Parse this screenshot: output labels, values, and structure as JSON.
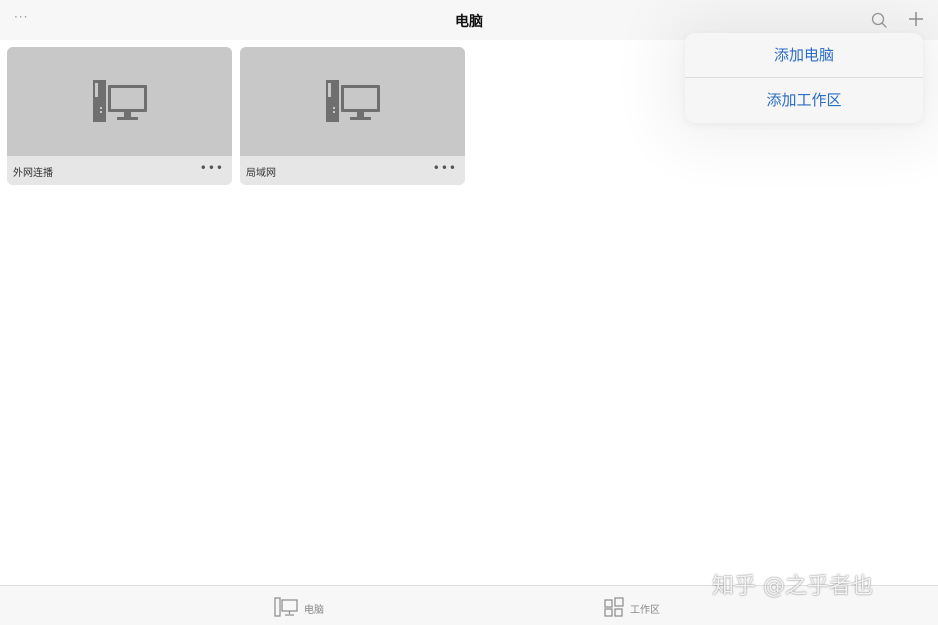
{
  "navbar": {
    "more_label": "···",
    "title": "电脑",
    "search_icon": "search-icon",
    "add_icon": "plus-icon"
  },
  "cards": [
    {
      "label": "外网连播",
      "more": "•••",
      "icon": "computer-icon"
    },
    {
      "label": "局域网",
      "more": "•••",
      "icon": "computer-icon"
    }
  ],
  "popover": {
    "items": [
      {
        "label": "添加电脑"
      },
      {
        "label": "添加工作区"
      }
    ]
  },
  "tabbar": {
    "tabs": [
      {
        "label": "电脑",
        "icon": "computer-icon"
      },
      {
        "label": "工作区",
        "icon": "workspace-icon"
      }
    ]
  },
  "watermark": "知乎 @之乎者也",
  "colors": {
    "accent": "#2b6cc4",
    "thumb_bg": "#c8c8c8",
    "card_footer": "#e6e6e6",
    "bar_bg": "#f7f7f7"
  }
}
